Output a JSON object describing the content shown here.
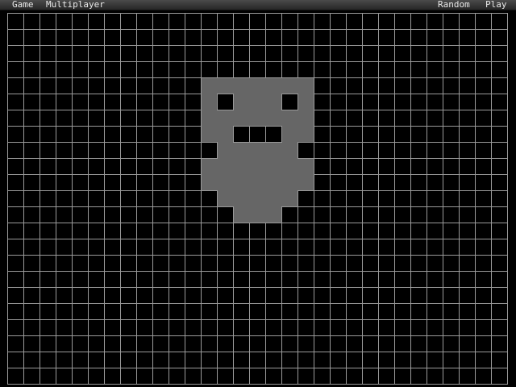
{
  "menu": {
    "game": "Game",
    "multiplayer": "Multiplayer",
    "random": "Random",
    "play": "Play"
  },
  "board": {
    "columns": 31,
    "rows": 23,
    "grid_color": "#9a9a9a",
    "background_color": "#000000",
    "cell_color": "#666666",
    "live_cells": [
      [
        12,
        4
      ],
      [
        13,
        4
      ],
      [
        14,
        4
      ],
      [
        15,
        4
      ],
      [
        16,
        4
      ],
      [
        17,
        4
      ],
      [
        18,
        4
      ],
      [
        12,
        5
      ],
      [
        14,
        5
      ],
      [
        15,
        5
      ],
      [
        16,
        5
      ],
      [
        18,
        5
      ],
      [
        12,
        6
      ],
      [
        13,
        6
      ],
      [
        14,
        6
      ],
      [
        15,
        6
      ],
      [
        16,
        6
      ],
      [
        17,
        6
      ],
      [
        18,
        6
      ],
      [
        12,
        7
      ],
      [
        13,
        7
      ],
      [
        17,
        7
      ],
      [
        18,
        7
      ],
      [
        13,
        8
      ],
      [
        14,
        8
      ],
      [
        15,
        8
      ],
      [
        16,
        8
      ],
      [
        17,
        8
      ],
      [
        12,
        9
      ],
      [
        13,
        9
      ],
      [
        14,
        9
      ],
      [
        15,
        9
      ],
      [
        16,
        9
      ],
      [
        17,
        9
      ],
      [
        18,
        9
      ],
      [
        12,
        10
      ],
      [
        13,
        10
      ],
      [
        14,
        10
      ],
      [
        15,
        10
      ],
      [
        16,
        10
      ],
      [
        17,
        10
      ],
      [
        18,
        10
      ],
      [
        13,
        11
      ],
      [
        14,
        11
      ],
      [
        15,
        11
      ],
      [
        16,
        11
      ],
      [
        17,
        11
      ],
      [
        14,
        12
      ],
      [
        15,
        12
      ],
      [
        16,
        12
      ]
    ]
  }
}
